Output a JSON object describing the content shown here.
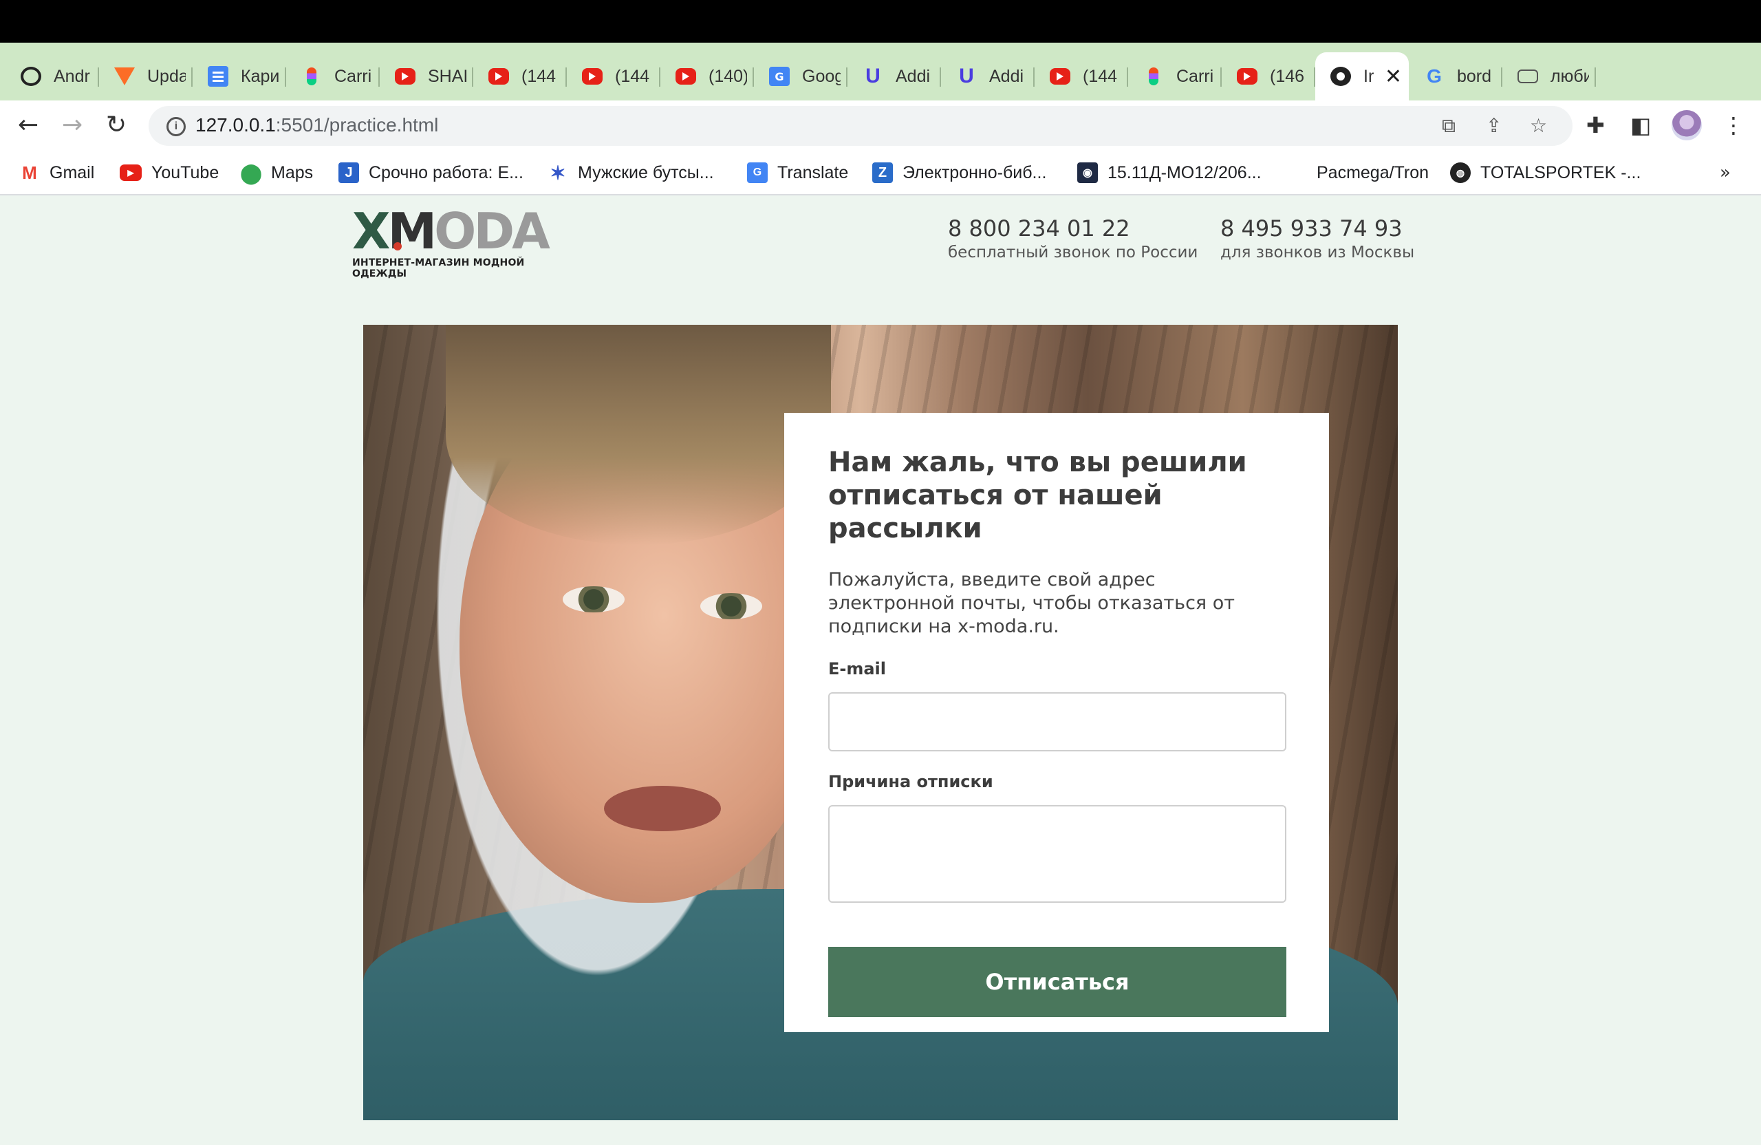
{
  "browser": {
    "tabs": [
      {
        "title": "Andr",
        "icon": "power-icon"
      },
      {
        "title": "Upda",
        "icon": "gitlab-icon"
      },
      {
        "title": "Кари",
        "icon": "docs-icon"
      },
      {
        "title": "Carri",
        "icon": "figma-icon"
      },
      {
        "title": "SHAI",
        "icon": "youtube-icon"
      },
      {
        "title": "(144",
        "icon": "youtube-icon"
      },
      {
        "title": "(144",
        "icon": "youtube-icon"
      },
      {
        "title": "(140)",
        "icon": "youtube-icon"
      },
      {
        "title": "Goog",
        "icon": "translate-icon"
      },
      {
        "title": "Addi",
        "icon": "u-icon"
      },
      {
        "title": "Addi",
        "icon": "u-icon"
      },
      {
        "title": "(144",
        "icon": "youtube-icon"
      },
      {
        "title": "Carri",
        "icon": "figma-icon"
      },
      {
        "title": "(146",
        "icon": "youtube-icon"
      },
      {
        "title": "Ir",
        "icon": "globe-icon",
        "active": true
      },
      {
        "title": "bord",
        "icon": "google-icon"
      },
      {
        "title": "люби",
        "icon": "ghost-icon"
      }
    ],
    "url_host": "127.0.0.1",
    "url_rest": ":5501/practice.html",
    "bookmarks": [
      {
        "label": "Gmail",
        "icon": "gmail-icon",
        "color": "#ea4335"
      },
      {
        "label": "YouTube",
        "icon": "youtube-icon",
        "color": "#e62117"
      },
      {
        "label": "Maps",
        "icon": "maps-icon",
        "color": "#34a853"
      },
      {
        "label": "Срочно работа: Е...",
        "icon": "j-icon",
        "color": "#2a63c9"
      },
      {
        "label": "Мужские бутсы...",
        "icon": "star-icon",
        "color": "#3456c8"
      },
      {
        "label": "Translate",
        "icon": "translate-icon",
        "color": "#4285f4"
      },
      {
        "label": "Электронно-биб...",
        "icon": "z-icon",
        "color": "#2a6cc9"
      },
      {
        "label": "15.11Д-МО12/206...",
        "icon": "emblem-icon",
        "color": "#1f2a44"
      },
      {
        "label": "Pacmega/Tron",
        "icon": "",
        "color": ""
      },
      {
        "label": "TOTALSPORTEK -...",
        "icon": "globe-icon",
        "color": "#222222"
      }
    ]
  },
  "site": {
    "logo_x": "X",
    "logo_m": "M",
    "logo_oda": "ODA",
    "logo_sub": "ИНТЕРНЕТ-МАГАЗИН МОДНОЙ ОДЕЖДЫ",
    "phone1": {
      "number": "8 800 234 01 22",
      "caption": "бесплатный звонок по России"
    },
    "phone2": {
      "number": "8 495 933 74 93",
      "caption": "для звонков из Москвы"
    },
    "form": {
      "title": "Нам жаль, что вы решили отписаться от нашей рассылки",
      "description": "Пожалуйста, введите свой адрес электронной почты, чтобы отказаться от подписки на x-moda.ru.",
      "email_label": "E-mail",
      "email_value": "",
      "reason_label": "Причина отписки",
      "reason_value": "",
      "submit_label": "Отписаться"
    },
    "colors": {
      "accent": "#4a775c",
      "page_bg": "#edf5ef"
    }
  }
}
